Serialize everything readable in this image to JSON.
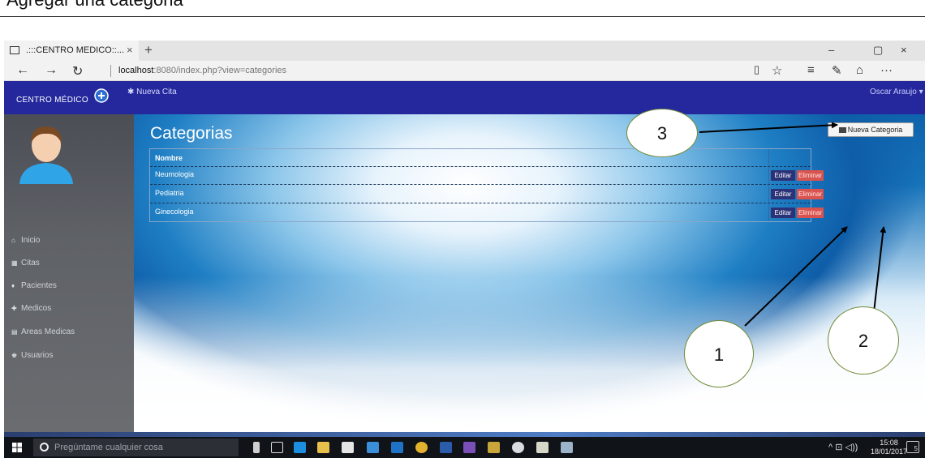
{
  "document": {
    "caption": "Agregar una categoria"
  },
  "browser": {
    "tab_title": ".:::CENTRO MEDICO::...",
    "tab_close": "×",
    "new_tab": "+",
    "window_controls": [
      "–",
      "▢",
      "×"
    ],
    "nav": {
      "back": "←",
      "forward": "→",
      "refresh": "↻"
    },
    "address_host": "localhost",
    "address_path": ":8080/index.php?view=categories",
    "tools": [
      "▯",
      "☆",
      "≡",
      "✎",
      "⌂",
      "···"
    ]
  },
  "app": {
    "brand": "CENTRO MÉDICO",
    "new_appointment": "✱ Nueva Cita",
    "user": "Oscar Araujo ▾",
    "sidebar": [
      {
        "label": "Inicio",
        "icon": "home-icon",
        "glyph": "⌂"
      },
      {
        "label": "Citas",
        "icon": "calendar-icon",
        "glyph": "▦"
      },
      {
        "label": "Pacientes",
        "icon": "patient-icon",
        "glyph": "♦"
      },
      {
        "label": "Medicos",
        "icon": "medic-icon",
        "glyph": "✚"
      },
      {
        "label": "Areas Medicas",
        "icon": "list-icon",
        "glyph": "▤"
      },
      {
        "label": "Usuarios",
        "icon": "users-icon",
        "glyph": "♚"
      }
    ],
    "page_title": "Categorias",
    "new_category_button": "Nueva Categoria",
    "table": {
      "header": "Nombre",
      "rows": [
        "Neumologia",
        "Pediatria",
        "Ginecologia"
      ],
      "edit_label": "Editar",
      "delete_label": "Eliminar"
    }
  },
  "taskbar": {
    "search_placeholder": "Pregúntame cualquier cosa",
    "tray": "^ ⊡ ◁))",
    "time": "15:08",
    "date": "18/01/2017",
    "notifications": "5"
  },
  "annotations": {
    "one": "1",
    "two": "2",
    "three": "3"
  },
  "colors": {
    "header": "#24289c",
    "edit": "#2c3277",
    "delete": "#d9534f",
    "annotation_border": "#6f8a36"
  }
}
